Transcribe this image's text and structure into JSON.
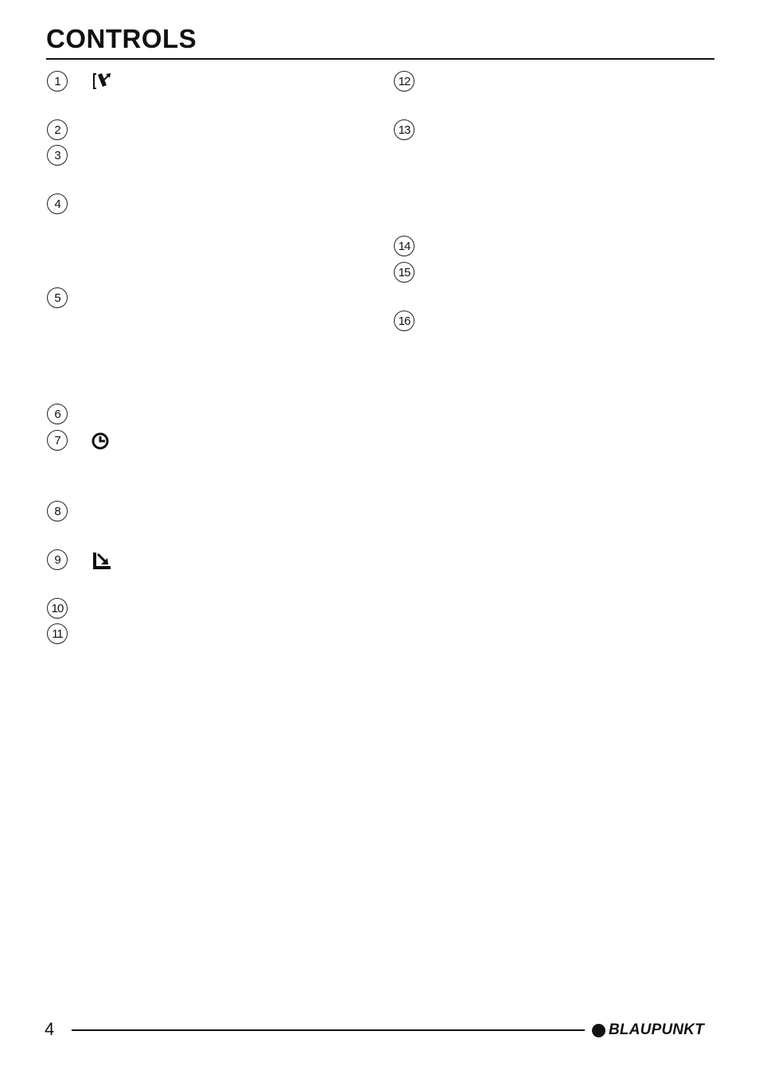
{
  "page": {
    "title": "CONTROLS",
    "page_number": "4",
    "brand": "BLAUPUNKT"
  },
  "left_column": [
    {
      "number": "1",
      "icon": "release-panel-icon"
    },
    {
      "number": "2",
      "icon": null
    },
    {
      "number": "3",
      "icon": null
    },
    {
      "number": "4",
      "icon": null
    },
    {
      "number": "5",
      "icon": null
    },
    {
      "number": "6",
      "icon": null
    },
    {
      "number": "7",
      "icon": "clock-icon"
    },
    {
      "number": "8",
      "icon": null
    },
    {
      "number": "9",
      "icon": "eject-icon"
    },
    {
      "number": "10",
      "icon": null
    },
    {
      "number": "11",
      "icon": null
    }
  ],
  "right_column": [
    {
      "number": "12"
    },
    {
      "number": "13"
    },
    {
      "number": "14"
    },
    {
      "number": "15"
    },
    {
      "number": "16"
    }
  ]
}
